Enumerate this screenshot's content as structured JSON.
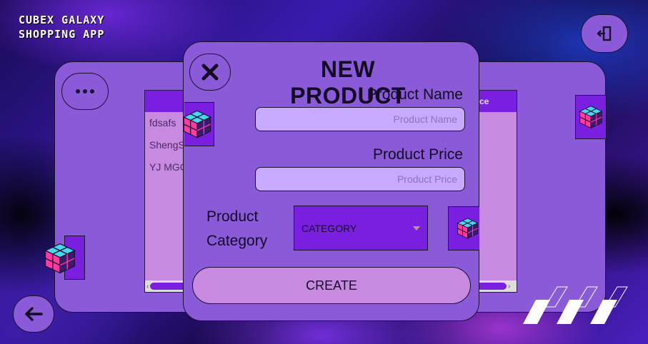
{
  "app": {
    "title_line1": "CUBEX GALAXY",
    "title_line2": "SHOPPING APP"
  },
  "left_panel": {
    "rows": [
      "fdsafs",
      "ShengS",
      "YJ MGC"
    ]
  },
  "right_panel": {
    "header_partial": "ce"
  },
  "modal": {
    "title": "NEW PRODUCT",
    "product_name_label": "Product Name",
    "product_name_placeholder": "Product Name",
    "product_price_label": "Product Price",
    "product_price_placeholder": "Product Price",
    "category_label_line1": "Product",
    "category_label_line2": "Category",
    "category_selected": "CATEGORY",
    "create_label": "CREATE"
  },
  "icons": {
    "logout": "logout-icon",
    "back": "arrow-left-icon",
    "more": "more-dots-icon",
    "close": "close-icon",
    "cube": "rubiks-cube-icon"
  },
  "colors": {
    "panel": "#8a5ad8",
    "accent": "#7a1fe0",
    "list_bg": "#c88ae0",
    "input_bg": "#c7a9ff"
  }
}
